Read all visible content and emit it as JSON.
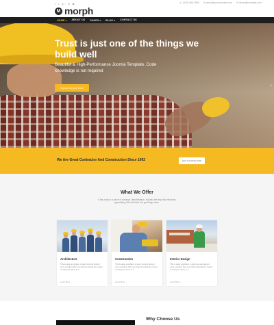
{
  "topbar": {
    "social_icons": [
      "facebook-icon",
      "twitter-icon",
      "google-plus-icon",
      "linkedin-icon",
      "youtube-icon"
    ],
    "social_glyphs": [
      "f",
      "t",
      "g+",
      "in",
      "▶"
    ],
    "brand": "morph",
    "brand_mark": "M",
    "contacts": [
      "☏ (123) 456-7890",
      "✉ demo@yourdomain.com",
      "✉ demo@example.com"
    ]
  },
  "nav": {
    "items": [
      "HOME ▾",
      "ABOUT US",
      "PAGES ▾",
      "BLOG ▾",
      "CONTACT US"
    ],
    "active_index": 0
  },
  "hero": {
    "title": "Trust is just one of the things we build well",
    "subtitle": "Beautiful & High-Performance Joomla Template. Code knowledge is not required",
    "button": "Explore Service Work",
    "next_arrow": "›"
  },
  "band": {
    "text": "We Are Great Contractor And Construction Since 1992",
    "button": "GET A QUOTE NOW"
  },
  "offer": {
    "title": "What We Offer",
    "description": "It has roots in a piece of classical Latin literature, but also the leap into electronic typesetting. Who will take it to get things done.",
    "cards": [
      {
        "title": "Architecture",
        "text": "This is quite a problem to work out and doing it more excellent than ever than it having the means of using the same in it.",
        "more": "Learn More →"
      },
      {
        "title": "Construction",
        "text": "This is quite a problem to work out and doing it more excellent than ever than it having the means of using the same in it.",
        "more": "Learn More →"
      },
      {
        "title": "Interior Design",
        "text": "This is quite a problem to work out and doing it more excellent than ever than it having the means of using the same in it.",
        "more": "Learn More →"
      }
    ]
  },
  "why": {
    "title": "Why Choose Us"
  },
  "colors": {
    "accent": "#f5b921",
    "nav_bg": "#1e1e1e",
    "band_bg": "#f5b921",
    "section_bg": "#f5f5f5"
  }
}
